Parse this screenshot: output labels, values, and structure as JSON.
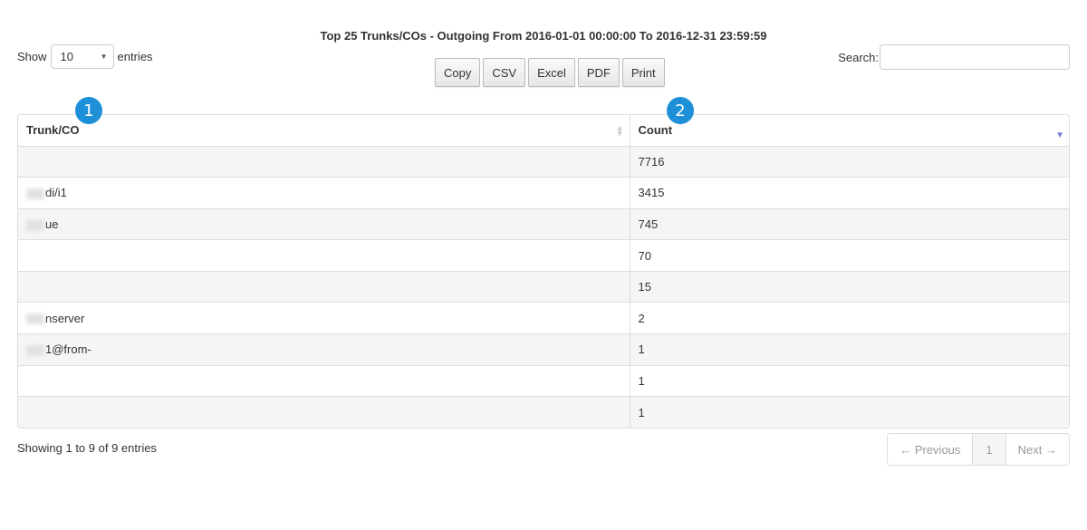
{
  "report": {
    "title": "Top 25 Trunks/COs - Outgoing From 2016-01-01 00:00:00 To 2016-12-31 23:59:59"
  },
  "length_control": {
    "prefix": "Show",
    "selected": "10",
    "suffix": "entries"
  },
  "export_buttons": [
    {
      "label": "Copy"
    },
    {
      "label": "CSV"
    },
    {
      "label": "Excel"
    },
    {
      "label": "PDF"
    },
    {
      "label": "Print"
    }
  ],
  "search": {
    "label": "Search:",
    "value": "",
    "placeholder": ""
  },
  "annotations": [
    {
      "label": "1"
    },
    {
      "label": "2"
    }
  ],
  "table": {
    "columns": [
      {
        "label": "Trunk/CO",
        "sort": "unsorted"
      },
      {
        "label": "Count",
        "sort": "descending"
      }
    ],
    "rows": [
      {
        "trunk": "",
        "redacted": false,
        "count": "7716"
      },
      {
        "trunk": "di/i1",
        "redacted": true,
        "count": "3415"
      },
      {
        "trunk": "ue",
        "redacted": true,
        "count": "745"
      },
      {
        "trunk": "",
        "redacted": false,
        "count": "70"
      },
      {
        "trunk": "",
        "redacted": false,
        "count": "15"
      },
      {
        "trunk": "nserver",
        "redacted": true,
        "count": "2"
      },
      {
        "trunk": "1@from-",
        "redacted": true,
        "count": "1"
      },
      {
        "trunk": "",
        "redacted": false,
        "count": "1"
      },
      {
        "trunk": "",
        "redacted": false,
        "count": "1"
      }
    ]
  },
  "footer": {
    "info": "Showing 1 to 9 of 9 entries",
    "pagination": {
      "previous": "← Previous",
      "current": "1",
      "next": "Next →"
    }
  }
}
